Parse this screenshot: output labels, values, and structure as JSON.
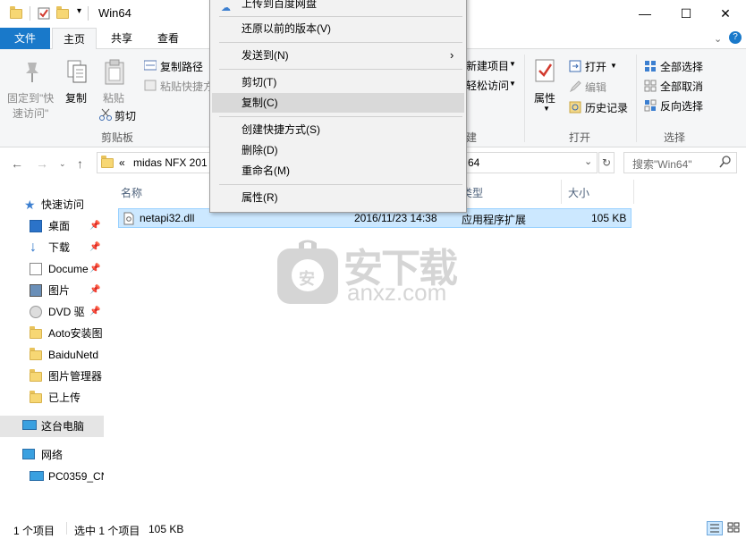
{
  "title": "Win64",
  "window_controls": {
    "minimize": "—",
    "maximize": "☐",
    "close": "✕"
  },
  "tabs": {
    "file": "文件",
    "home": "主页",
    "share": "共享",
    "view": "查看"
  },
  "ribbon": {
    "pin_quick_line1": "固定到\"快",
    "pin_quick_line2": "速访问\"",
    "copy": "复制",
    "paste": "粘贴",
    "copy_path": "复制路径",
    "paste_shortcut": "粘贴快捷方",
    "cut": "剪切",
    "clipboard_group": "剪贴板",
    "new_item": "新建项目",
    "easy_access": "轻松访问",
    "new_group_partial": "建",
    "properties": "属性",
    "open": "打开",
    "edit": "编辑",
    "history": "历史记录",
    "open_group": "打开",
    "select_all": "全部选择",
    "select_none": "全部取消",
    "invert_selection": "反向选择",
    "select_group": "选择"
  },
  "address": {
    "prefix": "«",
    "path_left": "midas NFX 201",
    "path_right": "64",
    "search_placeholder": "搜索\"Win64\""
  },
  "nav": {
    "quick_access": "快速访问",
    "desktop": "桌面",
    "downloads": "下载",
    "documents": "Docume",
    "pictures": "图片",
    "dvd": "DVD 驱",
    "aoto": "Aoto安装图",
    "baidu": "BaiduNetd",
    "pic_manager": "图片管理器",
    "uploaded": "已上传",
    "this_pc": "这台电脑",
    "network": "网络",
    "pc_name": "PC0359_CN"
  },
  "columns": {
    "name": "名称",
    "type": "类型",
    "size": "大小"
  },
  "file": {
    "name": "netapi32.dll",
    "date": "2016/11/23 14:38",
    "type": "应用程序扩展",
    "size": "105 KB"
  },
  "watermark": {
    "main": "安下载",
    "sub": "anxz.com",
    "badge": "安"
  },
  "status": {
    "count": "1 个项目",
    "selected": "选中 1 个项目",
    "sel_size": "105 KB"
  },
  "context_menu": {
    "upload_baidu": "上传到百度网盘",
    "restore_prev": "还原以前的版本(V)",
    "send_to": "发送到(N)",
    "cut": "剪切(T)",
    "copy": "复制(C)",
    "create_shortcut": "创建快捷方式(S)",
    "delete": "删除(D)",
    "rename": "重命名(M)",
    "properties": "属性(R)"
  },
  "colors": {
    "file_tab": "#1979ca",
    "selection": "#cce8ff",
    "selection_border": "#99d1ff",
    "menu_bg": "#f2f2f2",
    "menu_highlight": "#d9d9d9"
  }
}
